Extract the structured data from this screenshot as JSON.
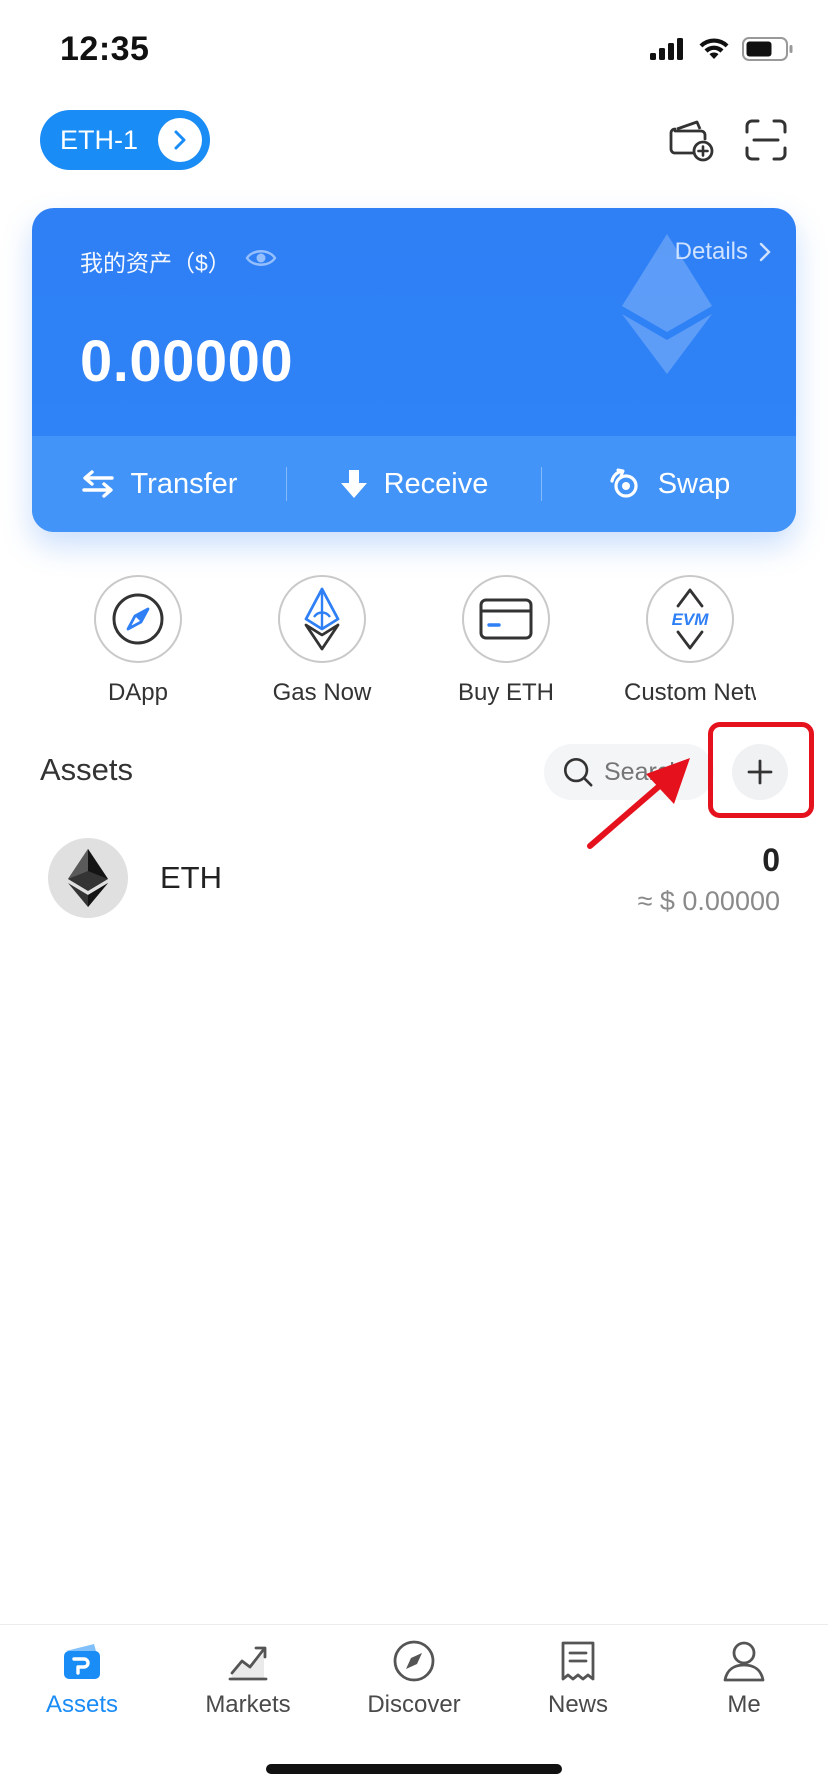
{
  "status_bar": {
    "time": "12:35",
    "icons": [
      "cellular-signal-icon",
      "wifi-icon",
      "battery-icon"
    ]
  },
  "header": {
    "wallet_name": "ETH-1",
    "icons": [
      "wallet-add-icon",
      "scan-icon"
    ]
  },
  "balance_card": {
    "title": "我的资产（$）",
    "details_label": "Details",
    "balance": "0.00000",
    "actions": [
      {
        "label": "Transfer",
        "icon": "transfer-arrows-icon"
      },
      {
        "label": "Receive",
        "icon": "download-arrow-icon"
      },
      {
        "label": "Swap",
        "icon": "swap-icon"
      }
    ]
  },
  "quick_actions": [
    {
      "label": "DApp",
      "icon": "compass-icon"
    },
    {
      "label": "Gas Now",
      "icon": "gas-ethereum-icon"
    },
    {
      "label": "Buy ETH",
      "icon": "card-icon"
    },
    {
      "label": "Custom Network",
      "icon": "evm-icon"
    }
  ],
  "assets": {
    "title": "Assets",
    "search_placeholder": "Search",
    "items": [
      {
        "symbol": "ETH",
        "amount": "0",
        "fiat_value": "≈ $ 0.00000"
      }
    ]
  },
  "tab_bar": {
    "items": [
      {
        "label": "Assets",
        "icon": "wallet-icon",
        "active": true
      },
      {
        "label": "Markets",
        "icon": "chart-icon",
        "active": false
      },
      {
        "label": "Discover",
        "icon": "compass-icon",
        "active": false
      },
      {
        "label": "News",
        "icon": "news-icon",
        "active": false
      },
      {
        "label": "Me",
        "icon": "person-icon",
        "active": false
      }
    ]
  },
  "colors": {
    "accent": "#1a8cf6",
    "card": "#2f7ff5",
    "annotation": "#e5121e"
  }
}
